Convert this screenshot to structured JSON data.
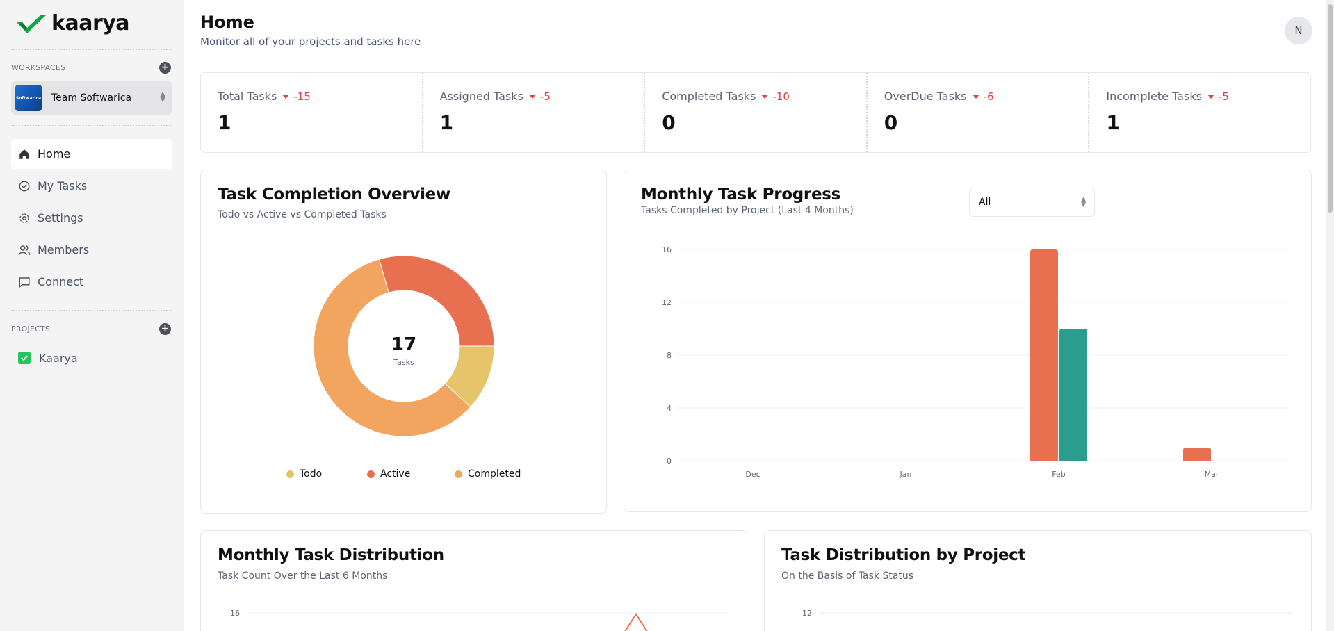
{
  "app": {
    "name": "kaarya"
  },
  "sidebar": {
    "workspaces_label": "WORKSPACES",
    "workspace": {
      "name": "Team Softwarica",
      "logo_text": "Softwarica"
    },
    "nav": [
      {
        "label": "Home",
        "icon": "home-icon",
        "active": true
      },
      {
        "label": "My Tasks",
        "icon": "check-circle-icon"
      },
      {
        "label": "Settings",
        "icon": "gear-icon"
      },
      {
        "label": "Members",
        "icon": "users-icon"
      },
      {
        "label": "Connect",
        "icon": "chat-icon"
      }
    ],
    "projects_label": "PROJECTS",
    "projects": [
      {
        "label": "Kaarya"
      }
    ]
  },
  "header": {
    "title": "Home",
    "subtitle": "Monitor all of your projects and tasks here",
    "avatar_initial": "N"
  },
  "stats": [
    {
      "label": "Total Tasks",
      "delta": "-15",
      "value": "1"
    },
    {
      "label": "Assigned Tasks",
      "delta": "-5",
      "value": "1"
    },
    {
      "label": "Completed Tasks",
      "delta": "-10",
      "value": "0"
    },
    {
      "label": "OverDue Tasks",
      "delta": "-6",
      "value": "0"
    },
    {
      "label": "Incomplete Tasks",
      "delta": "-5",
      "value": "1"
    }
  ],
  "cards": {
    "completion": {
      "title": "Task Completion Overview",
      "subtitle": "Todo vs Active vs Completed Tasks",
      "center_value": "17",
      "center_label": "Tasks"
    },
    "monthly_progress": {
      "title": "Monthly Task Progress",
      "subtitle": "Tasks Completed by Project (Last 4 Months)",
      "filter_value": "All"
    },
    "monthly_distribution": {
      "title": "Monthly Task Distribution",
      "subtitle": "Task Count Over the Last 6 Months"
    },
    "project_distribution": {
      "title": "Task Distribution by Project",
      "subtitle": "On the Basis of Task Status"
    }
  },
  "colors": {
    "todo": "#e6c46a",
    "active": "#e86f50",
    "completed": "#f2a55f",
    "teal": "#2a9d8f",
    "delta_red": "#e53e3e"
  },
  "chart_data": [
    {
      "type": "pie",
      "labels": [
        "Todo",
        "Active",
        "Completed"
      ],
      "values": [
        2,
        5,
        10
      ],
      "center": "17"
    },
    {
      "type": "bar",
      "categories": [
        "Dec",
        "Jan",
        "Feb",
        "Mar"
      ],
      "series": [
        {
          "values": [
            0,
            0,
            16,
            1
          ]
        },
        {
          "values": [
            0,
            0,
            10,
            0
          ]
        }
      ],
      "yticks": [
        0,
        4,
        8,
        12,
        16
      ],
      "ylim": [
        0,
        16
      ]
    },
    {
      "type": "line",
      "yticks_visible": [
        16
      ],
      "note": ""
    },
    {
      "type": "bar",
      "yticks_visible": [
        12
      ]
    }
  ]
}
